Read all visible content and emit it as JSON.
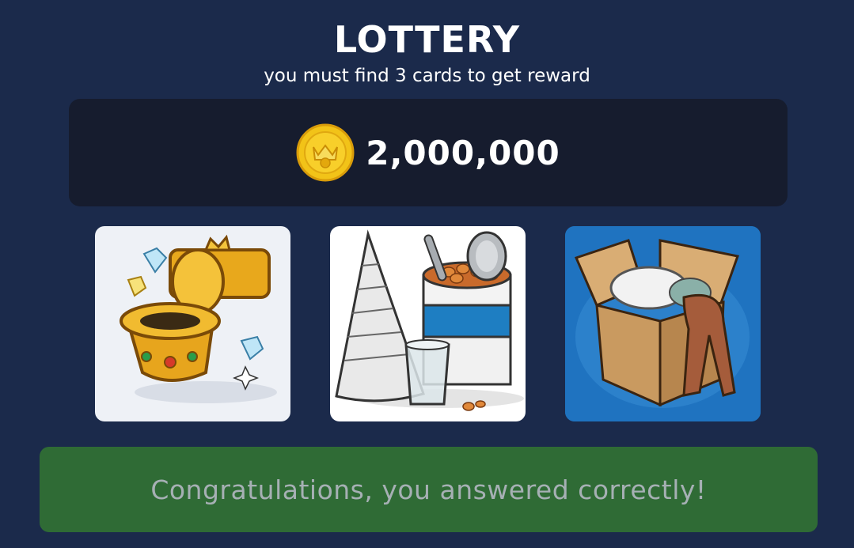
{
  "header": {
    "title": "LOTTERY",
    "subtitle": "you must find 3 cards to get reward"
  },
  "reward": {
    "icon": "gold-crown-coin-icon",
    "amount": "2,000,000"
  },
  "cards": [
    {
      "name": "golden-toilet-card",
      "icon": "golden-toilet-with-diamonds"
    },
    {
      "name": "newspaper-beans-glass-card",
      "icon": "newspaper-cone-bean-can-glass"
    },
    {
      "name": "cardboard-box-card",
      "icon": "box-with-pillow-and-blanket"
    }
  ],
  "result": {
    "message": "Congratulations, you answered correctly!"
  },
  "colors": {
    "background": "#1b2a4b",
    "panel": "#161c2e",
    "success": "#2f6b35",
    "coin": "#f2c318"
  }
}
